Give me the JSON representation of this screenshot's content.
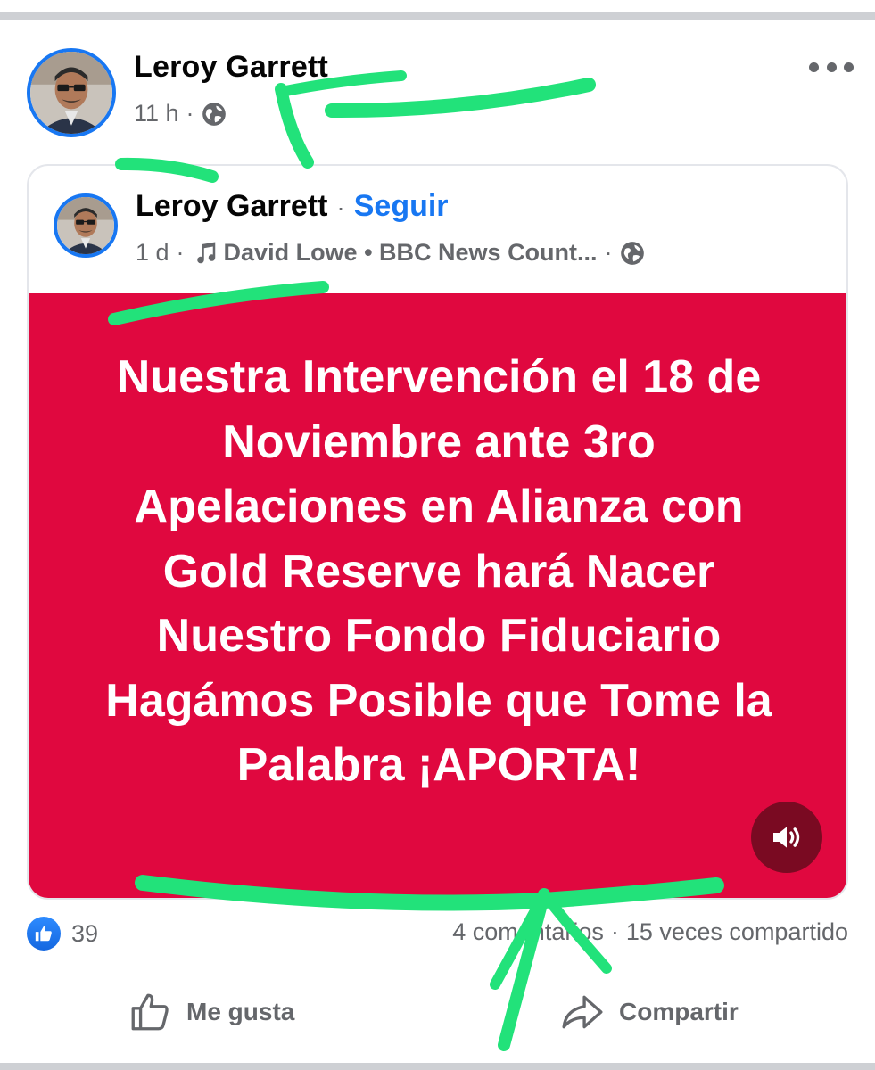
{
  "post": {
    "author": "Leroy Garrett",
    "time": "11 h",
    "separator": "·"
  },
  "shared_post": {
    "author": "Leroy Garrett",
    "dot": "·",
    "follow_label": "Seguir",
    "time": "1 d",
    "sep1": "·",
    "music": "David Lowe • BBC News Count...",
    "sep2": "·",
    "text": "Nuestra Intervención el 18 de Noviembre ante 3ro Apelaciones en Alianza con Gold Reserve hará Nacer Nuestro Fondo Fiduciario Hagámos Posible que Tome la Palabra ¡APORTA!",
    "background_color": "#e0083f"
  },
  "engagement": {
    "reaction_count": "39",
    "comments": "4 comentarios",
    "separator": "·",
    "shares": "15 veces compartido"
  },
  "actions": {
    "like_label": "Me gusta",
    "share_label": "Compartir"
  },
  "colors": {
    "accent": "#1877f2",
    "secondary_text": "#65676b",
    "annotation": "#22e27a"
  },
  "icons": [
    "globe-icon",
    "more-icon",
    "music-note-icon",
    "speaker-icon",
    "like-reaction-icon",
    "thumbs-up-icon",
    "share-icon"
  ]
}
